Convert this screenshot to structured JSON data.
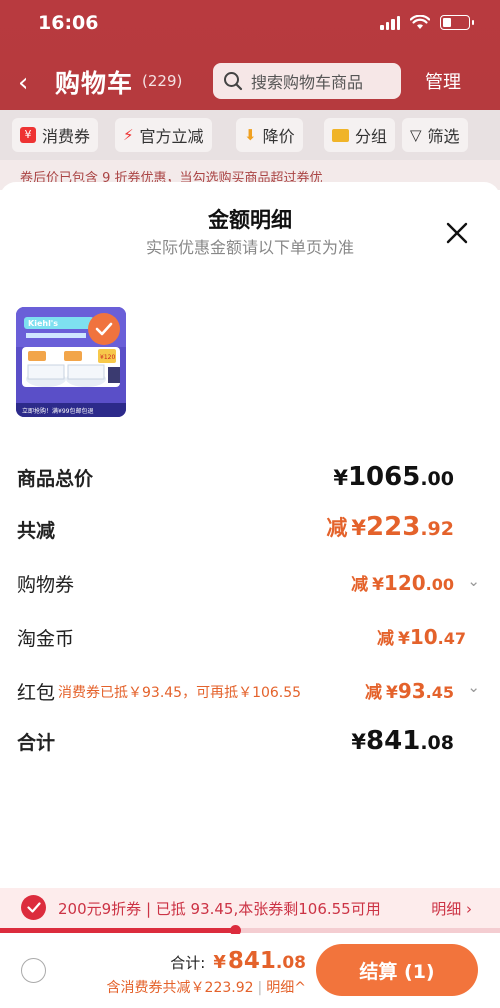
{
  "status_bar": {
    "time": "16:06"
  },
  "nav": {
    "back_glyph": "‹",
    "title": "购物车",
    "count": "(229)",
    "search_placeholder": "搜索购物车商品",
    "manage": "管理"
  },
  "filters": [
    {
      "label": "消费券",
      "icon": "coupon-icon"
    },
    {
      "label": "官方立减",
      "icon": "lightning-icon"
    },
    {
      "label": "降价",
      "icon": "price-drop-icon"
    },
    {
      "label": "分组",
      "icon": "folder-icon"
    },
    {
      "label": "筛选",
      "icon": "filter-icon"
    }
  ],
  "promo_strip": "卷后价已包含 9 折券优惠，当勾选购买商品超过券优",
  "sheet": {
    "title": "金额明细",
    "subtitle": "实际优惠金额请以下单页为准",
    "product": {
      "brand": "Kiehl's",
      "labels": [
        "¥120",
        "¥98"
      ],
      "footer": "立即抢购！满¥99包邮包退"
    },
    "rows": {
      "subtotal": {
        "label": "商品总价",
        "currency": "¥",
        "int": "1065",
        "dec": ".00"
      },
      "total_discount": {
        "label": "共减",
        "prefix": "减",
        "currency": "¥",
        "int": "223",
        "dec": ".92"
      },
      "shopping_coupon": {
        "label": "购物券",
        "prefix": "减",
        "currency": "¥",
        "int": "120",
        "dec": ".00"
      },
      "taojinbi": {
        "label": "淘金币",
        "prefix": "减",
        "currency": "¥",
        "int": "10",
        "dec": ".47"
      },
      "red_packet": {
        "label": "红包",
        "note": "消费券已抵￥93.45，可再抵￥106.55",
        "prefix": "减",
        "currency": "¥",
        "int": "93",
        "dec": ".45"
      },
      "total": {
        "label": "合计",
        "currency": "¥",
        "int": "841",
        "dec": ".08"
      }
    }
  },
  "coupon_bar": {
    "text": "200元9折券 | 已抵 93.45,本张券剩106.55可用",
    "detail": "明细 ›",
    "progress_fraction": 0.47
  },
  "checkout": {
    "total_label": "合计:",
    "currency": "¥",
    "total_int": "841",
    "total_dec": ".08",
    "discount_text": "含消费券共减￥223.92",
    "detail_text": "明细^",
    "pay_button": "结算 (1)"
  },
  "colors": {
    "header_red": "#b83a3f",
    "accent_orange": "#e4622b",
    "pay_button": "#f2743c",
    "coupon_red": "#dc2c3d"
  }
}
